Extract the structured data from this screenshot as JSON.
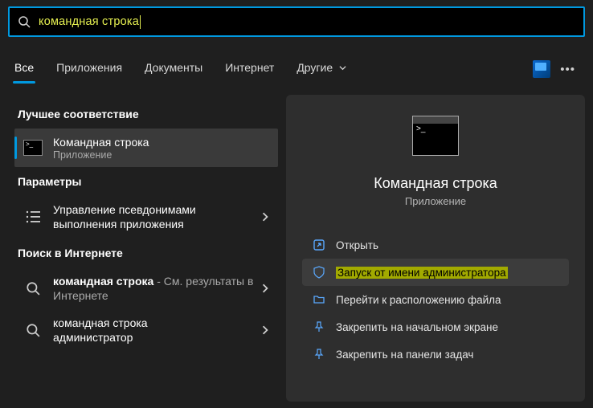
{
  "search": {
    "query": "командная строка"
  },
  "tabs": {
    "all": "Все",
    "apps": "Приложения",
    "docs": "Документы",
    "web": "Интернет",
    "more": "Другие"
  },
  "left": {
    "best_match": "Лучшее соответствие",
    "best": {
      "title": "Командная строка",
      "subtitle": "Приложение"
    },
    "settings_header": "Параметры",
    "alias": {
      "line1": "Управление псевдонимами",
      "line2": "выполнения приложения"
    },
    "web_header": "Поиск в Интернете",
    "web1": {
      "title": "командная строка",
      "suffix": " - См. результаты в Интернете"
    },
    "web2": {
      "line1": "командная строка",
      "line2": "администратор"
    }
  },
  "preview": {
    "title": "Командная строка",
    "subtitle": "Приложение"
  },
  "actions": {
    "open": "Открыть",
    "admin": "Запуск от имени администратора",
    "location": "Перейти к расположению файла",
    "pin_start": "Закрепить на начальном экране",
    "pin_taskbar": "Закрепить на панели задач"
  }
}
